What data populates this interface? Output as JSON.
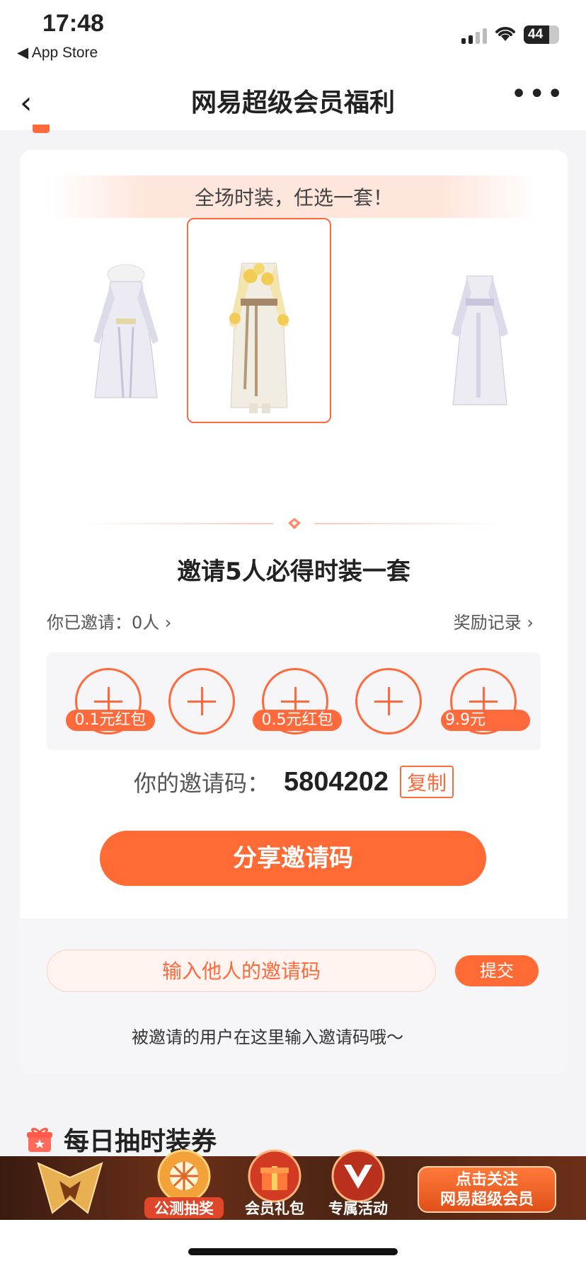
{
  "status_bar": {
    "time": "17:48",
    "back_app": "◀ App Store",
    "battery": "44"
  },
  "nav": {
    "back_glyph": "‹",
    "title": "网易超级会员福利",
    "more_glyph": "•••"
  },
  "card": {
    "banner": "全场时装，任选一套！",
    "outfits": [
      {
        "name": "outfit-1",
        "selected": false
      },
      {
        "name": "outfit-2",
        "selected": true
      },
      {
        "name": "outfit-3",
        "selected": false
      }
    ],
    "title": "邀请5人必得时装一套",
    "invited": "你已邀请：0人 ›",
    "reward_record": "奖励记录 ›",
    "slots": [
      {
        "tag": "0.1元红包"
      },
      {
        "tag": ""
      },
      {
        "tag": "0.5元红包"
      },
      {
        "tag": ""
      },
      {
        "tag": "9.9元"
      }
    ],
    "code_label": "你的邀请码：",
    "code_value": "5804202",
    "copy": "复制",
    "share": "分享邀请码",
    "input_placeholder": "输入他人的邀请码",
    "submit": "提交",
    "hint": "被邀请的用户在这里输入邀请码哦～"
  },
  "section2": {
    "title": "每日抽时装券"
  },
  "bottom_bar": {
    "items": [
      {
        "label": "公测抽奖"
      },
      {
        "label": "会员礼包"
      },
      {
        "label": "专属活动"
      }
    ],
    "follow_line1": "点击关注",
    "follow_line2": "网易超级会员"
  },
  "colors": {
    "accent": "#ff6a35",
    "background": "#f4f4f6"
  }
}
